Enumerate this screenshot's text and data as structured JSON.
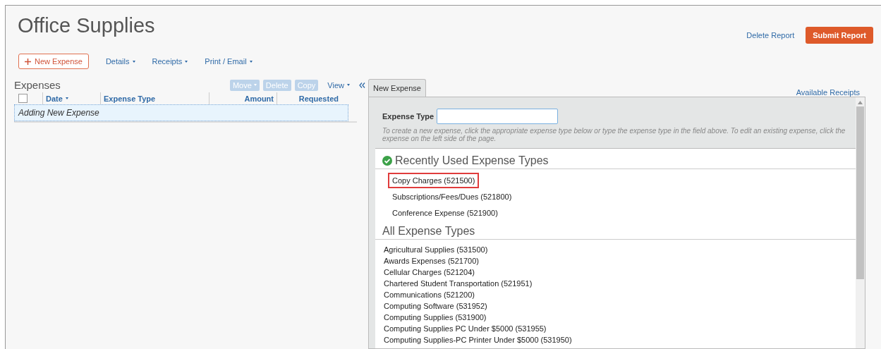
{
  "report": {
    "title": "Office Supplies",
    "links": [
      "Delete Report"
    ],
    "submit_button": "Submit Report"
  },
  "toolbar": [
    {
      "label": "New Expense",
      "kind": "primary"
    },
    {
      "label": "Details",
      "kind": "menu"
    },
    {
      "label": "Receipts",
      "kind": "menu"
    },
    {
      "label": "Print / Email",
      "kind": "menu"
    }
  ],
  "expenses": {
    "title": "Expenses",
    "actions": [
      {
        "label": "Move",
        "disabled": true,
        "menu": true
      },
      {
        "label": "Delete",
        "disabled": true,
        "menu": false
      },
      {
        "label": "Copy",
        "disabled": true,
        "menu": false
      }
    ],
    "view": "View",
    "select_all": {
      "checked": false
    },
    "columns": [
      {
        "label": "Date",
        "sorted": true
      },
      {
        "label": "Expense Type",
        "sorted": false
      },
      {
        "label": "Amount",
        "sorted": false
      },
      {
        "label": "Requested",
        "sorted": false
      }
    ],
    "rows": [
      {
        "text": "Adding New Expense",
        "selected": true
      }
    ]
  },
  "panel": {
    "tabs": [
      {
        "label": "New Expense",
        "selected": true
      }
    ],
    "link": "Available Receipts",
    "field": {
      "label": "Expense Type"
    },
    "hint": "To create a new expense, click the appropriate expense type below or type the expense type in the field above. To edit an existing expense, click the expense on the left side of the page.",
    "recent": {
      "title": "Recently Used Expense Types",
      "items": [
        {
          "text": "Copy Charges (521500)",
          "highlighted": true
        },
        {
          "text": "Subscriptions/Fees/Dues (521800)",
          "highlighted": false
        },
        {
          "text": "Conference Expense (521900)",
          "highlighted": false
        }
      ]
    },
    "all": {
      "title": "All Expense Types",
      "items": [
        "Agricultural Supplies (531500)",
        "Awards Expenses (521700)",
        "Cellular Charges (521204)",
        "Chartered Student Transportation (521951)",
        "Communications (521200)",
        "Computing Software (531952)",
        "Computing Supplies (531900)",
        "Computing Supplies PC Under $5000 (531955)",
        "Computing Supplies-PC Printer Under $5000 (531950)"
      ]
    }
  }
}
